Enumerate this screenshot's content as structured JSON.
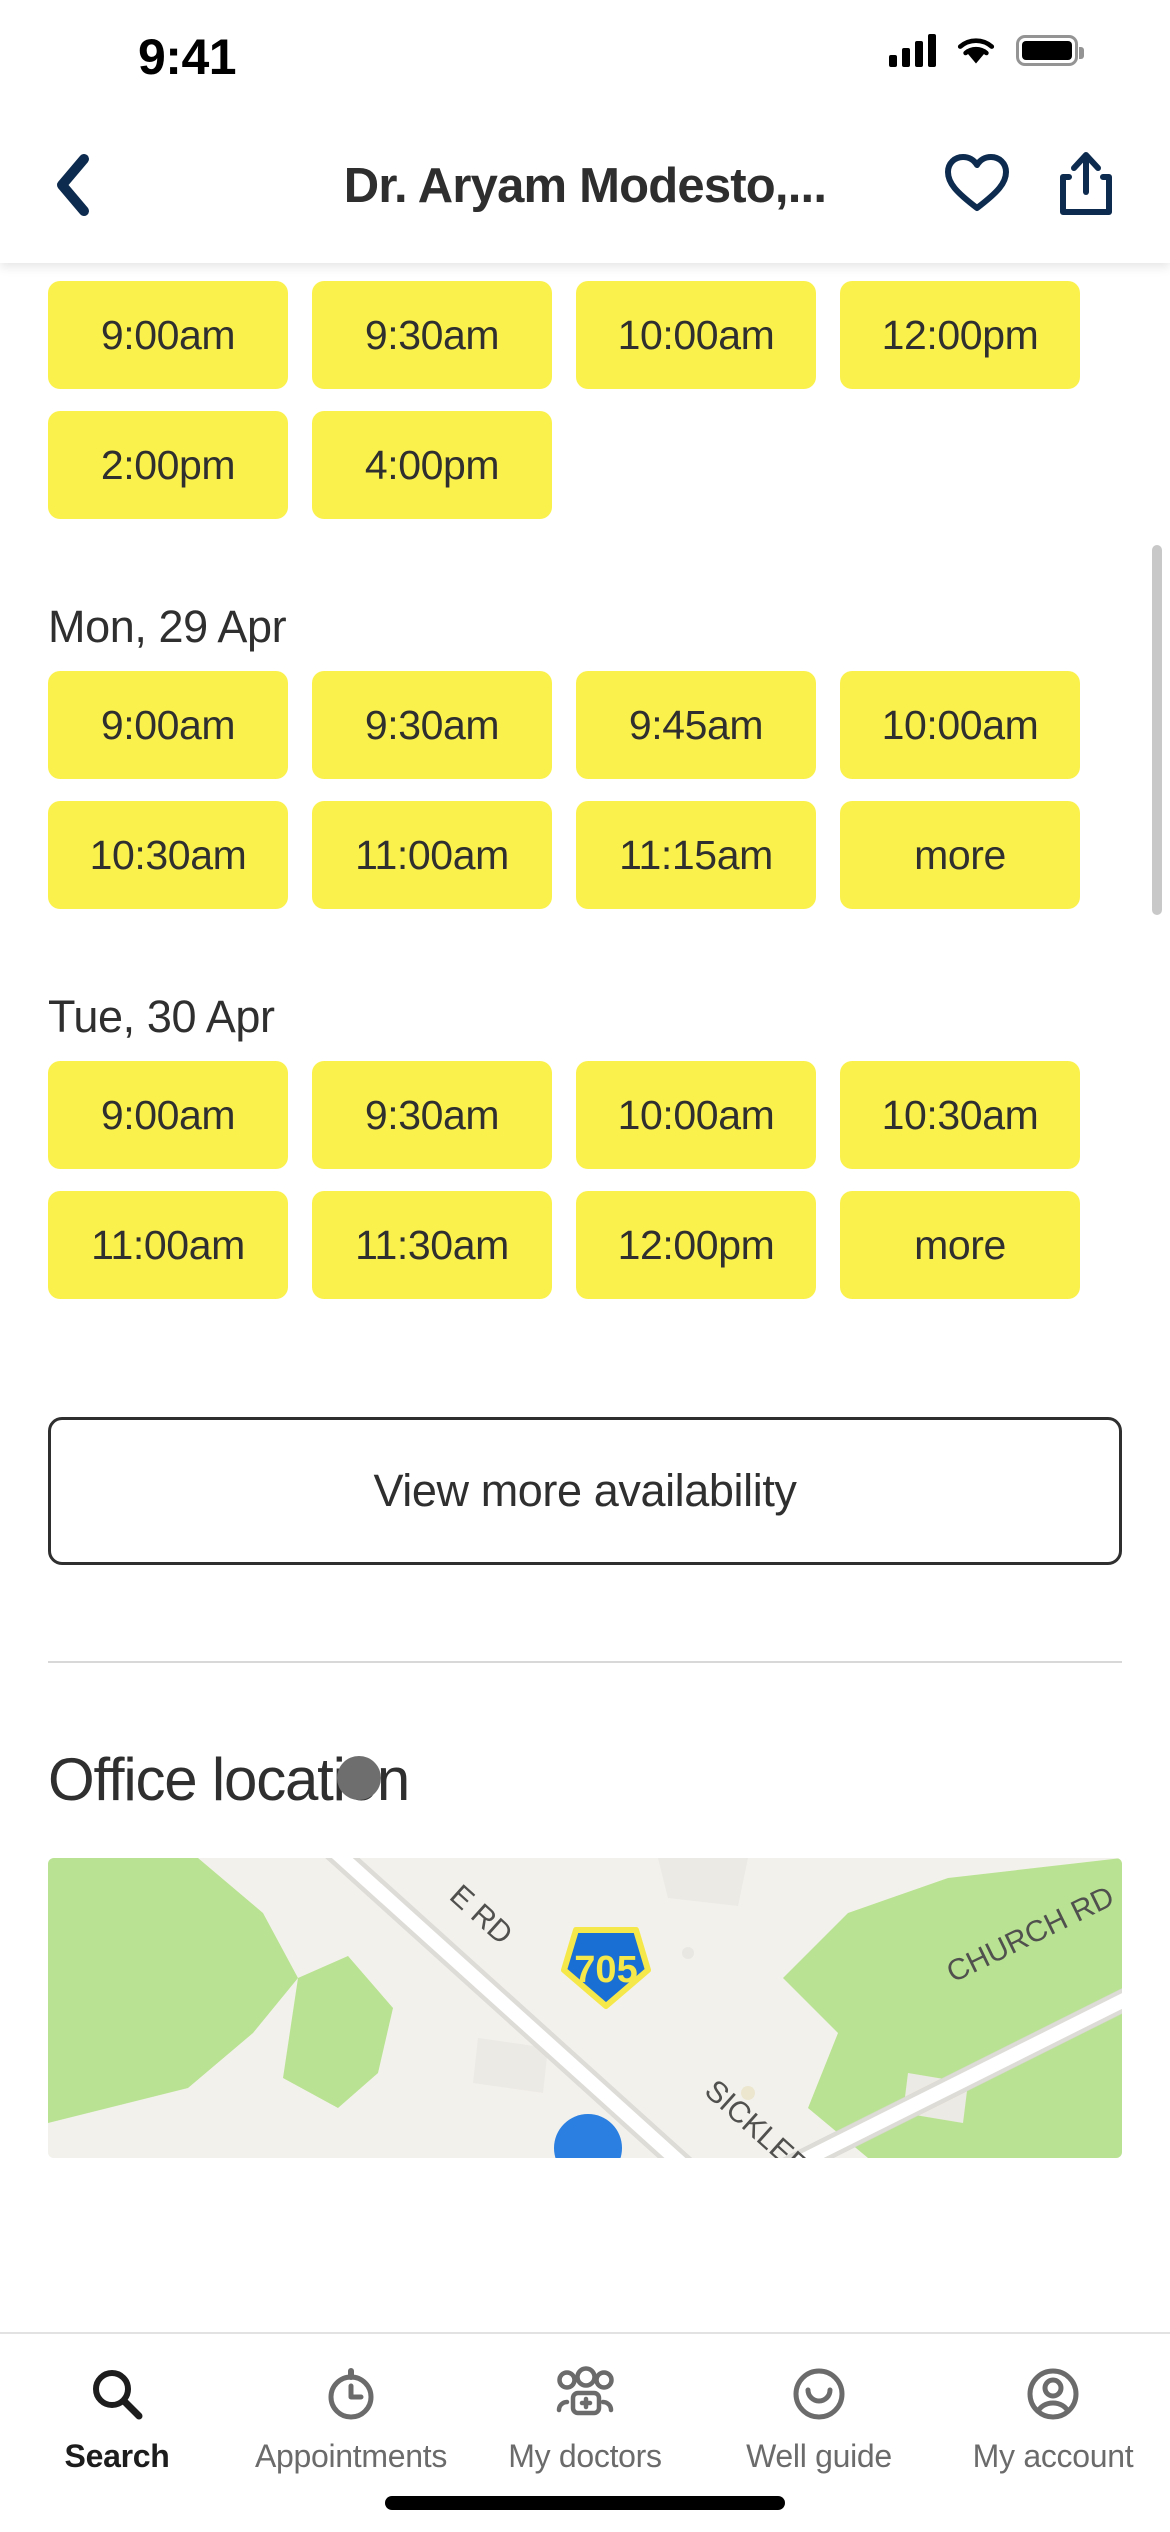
{
  "status_bar": {
    "time": "9:41",
    "cellular_icon": "signal-bars-icon",
    "wifi_icon": "wifi-icon",
    "battery_icon": "battery-icon"
  },
  "nav": {
    "back_icon": "chevron-left-icon",
    "title": "Dr. Aryam Modesto,...",
    "favorite_icon": "heart-icon",
    "share_icon": "share-icon"
  },
  "availability": {
    "partial_day_slots": [
      "9:00am",
      "9:30am",
      "10:00am",
      "12:00pm",
      "2:00pm",
      "4:00pm"
    ],
    "days": [
      {
        "date_label": "Mon, 29 Apr",
        "slots": [
          "9:00am",
          "9:30am",
          "9:45am",
          "10:00am",
          "10:30am",
          "11:00am",
          "11:15am",
          "more"
        ]
      },
      {
        "date_label": "Tue, 30 Apr",
        "slots": [
          "9:00am",
          "9:30am",
          "10:00am",
          "10:30am",
          "11:00am",
          "11:30am",
          "12:00pm",
          "more"
        ]
      }
    ],
    "view_more_label": "View more availability"
  },
  "office_location": {
    "title": "Office location",
    "map": {
      "route_shield": "705",
      "road_labels": [
        "E RD",
        "CHURCH RD",
        "SICKLERVI"
      ],
      "marker_icon": "location-pin-icon",
      "land_color": "#f3f1ec",
      "park_color": "#b9e392",
      "road_color": "#ffffff",
      "shield_fill": "#1a6fd4",
      "shield_text_color": "#f5e84a"
    }
  },
  "colors": {
    "slot_yellow": "#fbf14d",
    "slot_text": "#2f2f2f",
    "nav_accent": "#0d2b4e",
    "tab_active": "#1d1d1d",
    "tab_inactive": "#6b6b6b"
  },
  "tab_bar": {
    "items": [
      {
        "label": "Search",
        "icon": "search-icon",
        "active": true
      },
      {
        "label": "Appointments",
        "icon": "stopwatch-icon",
        "active": false
      },
      {
        "label": "My doctors",
        "icon": "people-add-icon",
        "active": false
      },
      {
        "label": "Well guide",
        "icon": "smiley-icon",
        "active": false
      },
      {
        "label": "My account",
        "icon": "account-icon",
        "active": false
      }
    ]
  }
}
